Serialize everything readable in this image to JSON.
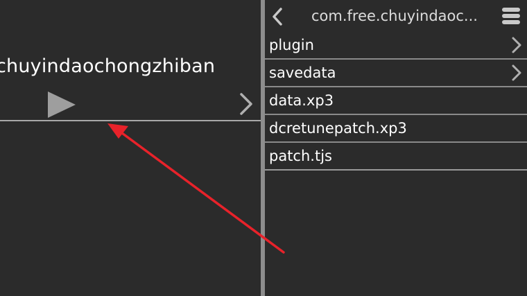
{
  "left_panel": {
    "game_title": "chuyindaochongzhiban",
    "play_icon": "play-icon",
    "chevron_icon": "chevron-right-icon"
  },
  "right_panel": {
    "back_icon": "chevron-left-icon",
    "path_title": "com.free.chuyindaoc...",
    "menu_icon": "menu-icon",
    "files": [
      {
        "name": "plugin",
        "is_folder": true
      },
      {
        "name": "savedata",
        "is_folder": true
      },
      {
        "name": "data.xp3",
        "is_folder": false
      },
      {
        "name": "dcretunepatch.xp3",
        "is_folder": false
      },
      {
        "name": "patch.tjs",
        "is_folder": false
      }
    ]
  },
  "colors": {
    "background": "#2b2b2b",
    "divider": "#8a8a8a",
    "splitter": "#8d8d8d",
    "icon_gray": "#a9a9a9",
    "annotation_red": "#e8222a"
  }
}
